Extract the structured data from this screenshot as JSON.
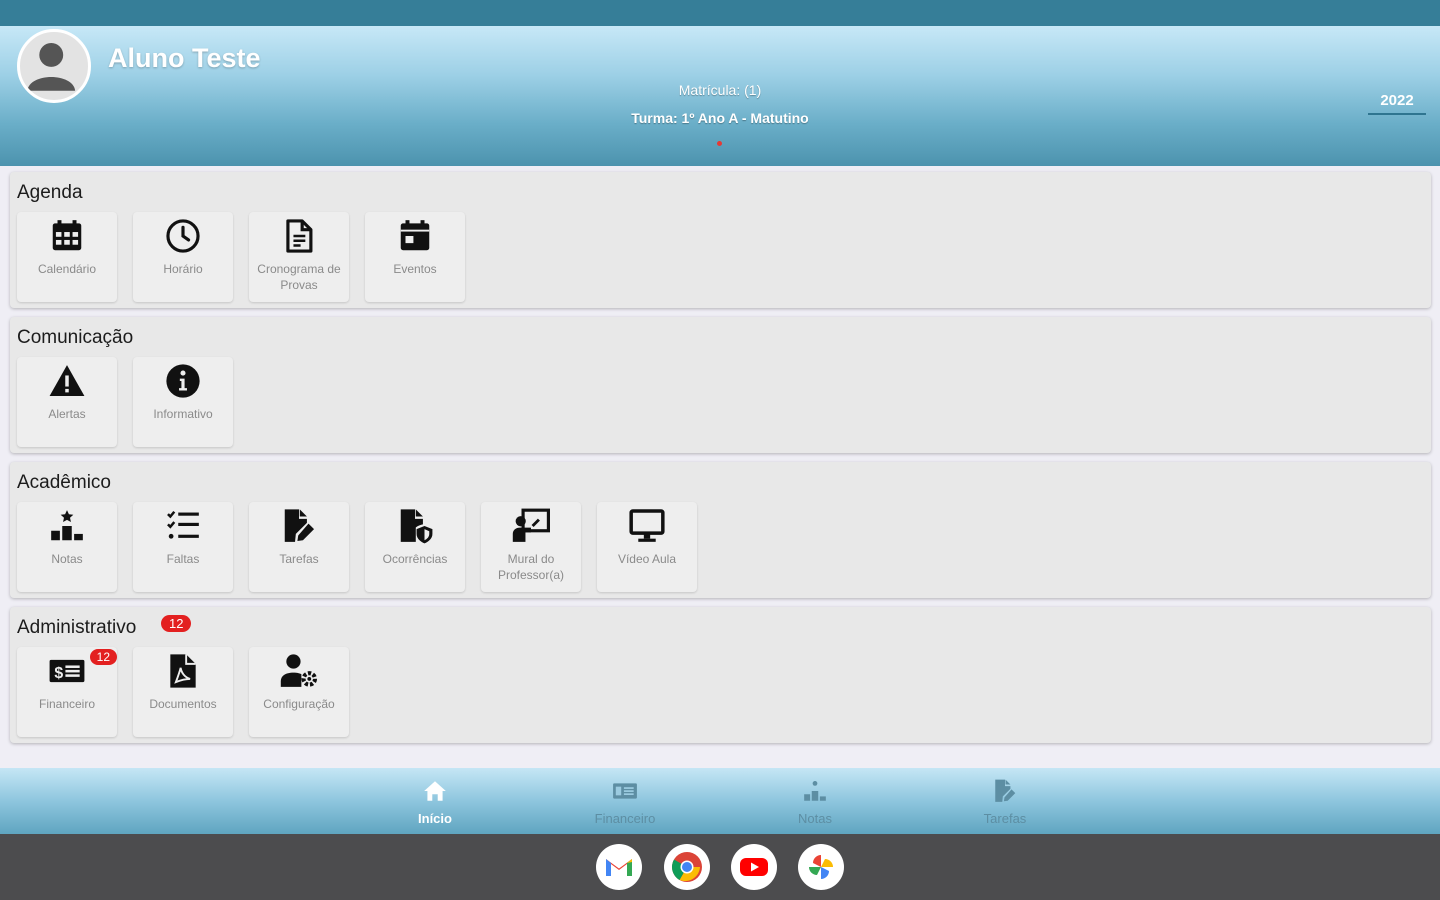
{
  "header": {
    "student_name": "Aluno Teste",
    "matricula": "Matrícula: (1)",
    "turma": "Turma: 1º Ano A - Matutino",
    "year": "2022"
  },
  "sections": {
    "agenda": {
      "title": "Agenda",
      "tiles": [
        {
          "label": "Calendário",
          "icon": "calendar-icon"
        },
        {
          "label": "Horário",
          "icon": "clock-icon"
        },
        {
          "label": "Cronograma de Provas",
          "icon": "document-icon"
        },
        {
          "label": "Eventos",
          "icon": "event-icon"
        }
      ]
    },
    "comunicacao": {
      "title": "Comunicação",
      "tiles": [
        {
          "label": "Alertas",
          "icon": "warning-icon"
        },
        {
          "label": "Informativo",
          "icon": "info-icon"
        }
      ]
    },
    "academico": {
      "title": "Acadêmico",
      "tiles": [
        {
          "label": "Notas",
          "icon": "podium-icon"
        },
        {
          "label": "Faltas",
          "icon": "checklist-icon"
        },
        {
          "label": "Tarefas",
          "icon": "file-edit-icon"
        },
        {
          "label": "Ocorrências",
          "icon": "file-shield-icon"
        },
        {
          "label": "Mural do Professor(a)",
          "icon": "teacher-board-icon"
        },
        {
          "label": "Vídeo Aula",
          "icon": "monitor-icon"
        }
      ]
    },
    "administrativo": {
      "title": "Administrativo",
      "badge": "12",
      "tiles": [
        {
          "label": "Financeiro",
          "icon": "money-icon",
          "badge": "12"
        },
        {
          "label": "Documentos",
          "icon": "pdf-file-icon"
        },
        {
          "label": "Configuração",
          "icon": "user-settings-icon"
        }
      ]
    }
  },
  "bottom_nav": {
    "items": [
      {
        "label": "Início",
        "icon": "home-icon",
        "active": true
      },
      {
        "label": "Financeiro",
        "icon": "money-icon"
      },
      {
        "label": "Notas",
        "icon": "podium-icon"
      },
      {
        "label": "Tarefas",
        "icon": "file-edit-icon"
      }
    ]
  },
  "dock": {
    "apps": [
      "gmail-icon",
      "chrome-icon",
      "youtube-icon",
      "photos-icon"
    ]
  },
  "colors": {
    "status_bar": "#367e98",
    "badge": "#e32020",
    "icon": "#111111",
    "label": "#8a8a8a"
  }
}
